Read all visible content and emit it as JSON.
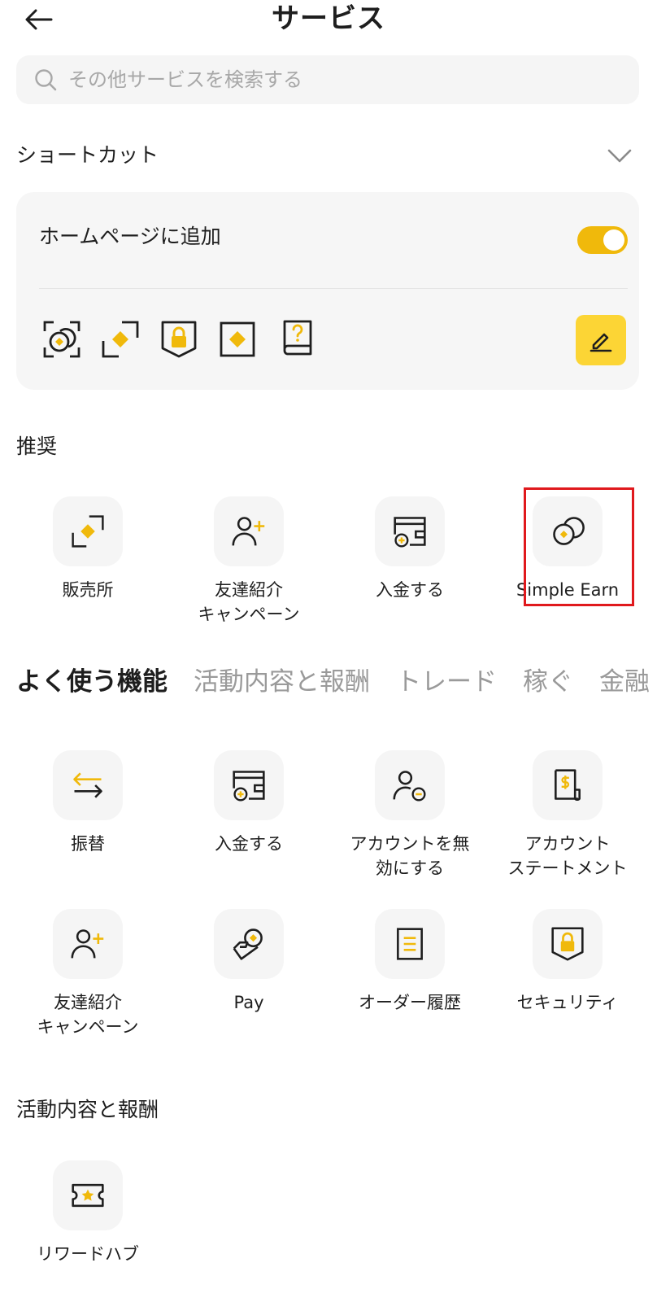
{
  "header": {
    "title": "サービス",
    "back_icon": "arrow-left-icon"
  },
  "search": {
    "placeholder": "その他サービスを検索する",
    "icon": "search-icon"
  },
  "shortcut": {
    "title": "ショートカット",
    "homepage_label": "ホームページに追加",
    "toggle_on": true,
    "icons": [
      "earn-coins-icon",
      "exchange-icon",
      "security-shield-icon",
      "trade-diamond-icon",
      "help-book-icon"
    ],
    "edit_icon": "pencil-icon"
  },
  "recommended": {
    "title": "推奨",
    "items": [
      {
        "label": "販売所",
        "icon": "exchange-icon"
      },
      {
        "label": "友達紹介\nキャンペーン",
        "icon": "add-user-icon"
      },
      {
        "label": "入金する",
        "icon": "deposit-wallet-icon"
      },
      {
        "label": "Simple Earn",
        "icon": "earn-coins-icon"
      }
    ]
  },
  "tabs": [
    "よく使う機能",
    "活動内容と報酬",
    "トレード",
    "稼ぐ",
    "金融"
  ],
  "frequent": {
    "items": [
      {
        "label": "振替",
        "icon": "transfer-arrows-icon"
      },
      {
        "label": "入金する",
        "icon": "deposit-wallet-icon"
      },
      {
        "label": "アカウントを無\n効にする",
        "icon": "disable-account-icon"
      },
      {
        "label": "アカウント\nステートメント",
        "icon": "statement-icon"
      },
      {
        "label": "友達紹介\nキャンペーン",
        "icon": "add-user-icon"
      },
      {
        "label": "Pay",
        "icon": "pay-hand-icon"
      },
      {
        "label": "オーダー履歴",
        "icon": "order-history-icon"
      },
      {
        "label": "セキュリティ",
        "icon": "security-shield-icon"
      }
    ]
  },
  "activities": {
    "title": "活動内容と報酬",
    "items": [
      {
        "label": "リワードハブ",
        "icon": "reward-ticket-icon"
      }
    ]
  },
  "colors": {
    "accent": "#f0b90b",
    "highlight": "#e0191d",
    "tile_bg": "#f5f5f5",
    "muted_text": "#9a9a9a"
  }
}
